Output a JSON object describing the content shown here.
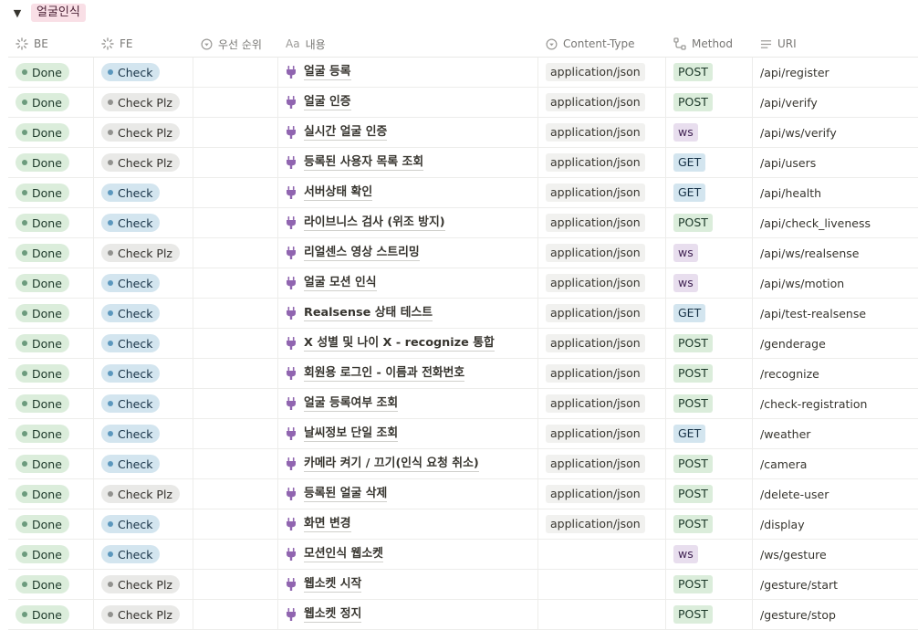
{
  "group": {
    "caret": "▼",
    "label": "얼굴인식",
    "label_color": "#f9dfe6"
  },
  "columns": [
    {
      "label": "BE",
      "icon": "loading-icon"
    },
    {
      "label": "FE",
      "icon": "loading-icon"
    },
    {
      "label": "우선 순위",
      "icon": "select-icon"
    },
    {
      "label": "내용",
      "icon": "text-icon",
      "prefix": "Aa"
    },
    {
      "label": "Content-Type",
      "icon": "select-icon"
    },
    {
      "label": "Method",
      "icon": "relation-icon"
    },
    {
      "label": "URI",
      "icon": "lines-icon"
    }
  ],
  "status_labels": {
    "done": "Done",
    "check": "Check",
    "plz": "Check Plz"
  },
  "colors": {
    "done": "#dbeddb",
    "check": "#d3e5ef",
    "plz": "#e9e9e7",
    "ws": "#e8deee",
    "icon_purple": "#9065b0"
  },
  "rows": [
    {
      "be": "Done",
      "fe": "Check",
      "fe_type": "check",
      "name": "얼굴 등록",
      "ct": "application/json",
      "method": "POST",
      "uri": "/api/register"
    },
    {
      "be": "Done",
      "fe": "Check Plz",
      "fe_type": "plz",
      "name": "얼굴 인증",
      "ct": "application/json",
      "method": "POST",
      "uri": "/api/verify"
    },
    {
      "be": "Done",
      "fe": "Check Plz",
      "fe_type": "plz",
      "name": "실시간 얼굴 인증",
      "ct": "application/json",
      "method": "ws",
      "uri": "/api/ws/verify"
    },
    {
      "be": "Done",
      "fe": "Check Plz",
      "fe_type": "plz",
      "name": "등록된 사용자 목록 조회",
      "ct": "application/json",
      "method": "GET",
      "uri": "/api/users"
    },
    {
      "be": "Done",
      "fe": "Check",
      "fe_type": "check",
      "name": "서버상태 확인",
      "ct": "application/json",
      "method": "GET",
      "uri": "/api/health"
    },
    {
      "be": "Done",
      "fe": "Check",
      "fe_type": "check",
      "name": "라이브니스 검사 (위조 방지)",
      "ct": "application/json",
      "method": "POST",
      "uri": "/api/check_liveness"
    },
    {
      "be": "Done",
      "fe": "Check Plz",
      "fe_type": "plz",
      "name": "리얼센스 영상 스트리밍",
      "ct": "application/json",
      "method": "ws",
      "uri": "/api/ws/realsense"
    },
    {
      "be": "Done",
      "fe": "Check",
      "fe_type": "check",
      "name": "얼굴 모션 인식",
      "ct": "application/json",
      "method": "ws",
      "uri": "/api/ws/motion"
    },
    {
      "be": "Done",
      "fe": "Check",
      "fe_type": "check",
      "name": "Realsense 상태 테스트",
      "ct": "application/json",
      "method": "GET",
      "uri": "/api/test-realsense"
    },
    {
      "be": "Done",
      "fe": "Check",
      "fe_type": "check",
      "name": "X 성별 및 나이 X  - recognize 통합",
      "ct": "application/json",
      "method": "POST",
      "uri": "/genderage"
    },
    {
      "be": "Done",
      "fe": "Check",
      "fe_type": "check",
      "name": "회원용 로그인 - 이름과 전화번호",
      "ct": "application/json",
      "method": "POST",
      "uri": "/recognize"
    },
    {
      "be": "Done",
      "fe": "Check",
      "fe_type": "check",
      "name": "얼굴 등록여부 조회",
      "ct": "application/json",
      "method": "POST",
      "uri": "/check-registration"
    },
    {
      "be": "Done",
      "fe": "Check",
      "fe_type": "check",
      "name": "날씨정보 단일 조회",
      "ct": "application/json",
      "method": "GET",
      "uri": "/weather"
    },
    {
      "be": "Done",
      "fe": "Check",
      "fe_type": "check",
      "name": "카메라 켜기 / 끄기(인식 요청 취소)",
      "ct": "application/json",
      "method": "POST",
      "uri": "/camera"
    },
    {
      "be": "Done",
      "fe": "Check Plz",
      "fe_type": "plz",
      "name": "등록된 얼굴 삭제",
      "ct": "application/json",
      "method": "POST",
      "uri": "/delete-user"
    },
    {
      "be": "Done",
      "fe": "Check",
      "fe_type": "check",
      "name": "화면 변경",
      "ct": "application/json",
      "method": "POST",
      "uri": "/display"
    },
    {
      "be": "Done",
      "fe": "Check",
      "fe_type": "check",
      "name": "모션인식 웹소켓",
      "ct": "",
      "method": "ws",
      "uri": "/ws/gesture"
    },
    {
      "be": "Done",
      "fe": "Check Plz",
      "fe_type": "plz",
      "name": "웹소켓 시작",
      "ct": "",
      "method": "POST",
      "uri": "/gesture/start"
    },
    {
      "be": "Done",
      "fe": "Check Plz",
      "fe_type": "plz",
      "name": "웹소켓 정지",
      "ct": "",
      "method": "POST",
      "uri": "/gesture/stop"
    }
  ]
}
